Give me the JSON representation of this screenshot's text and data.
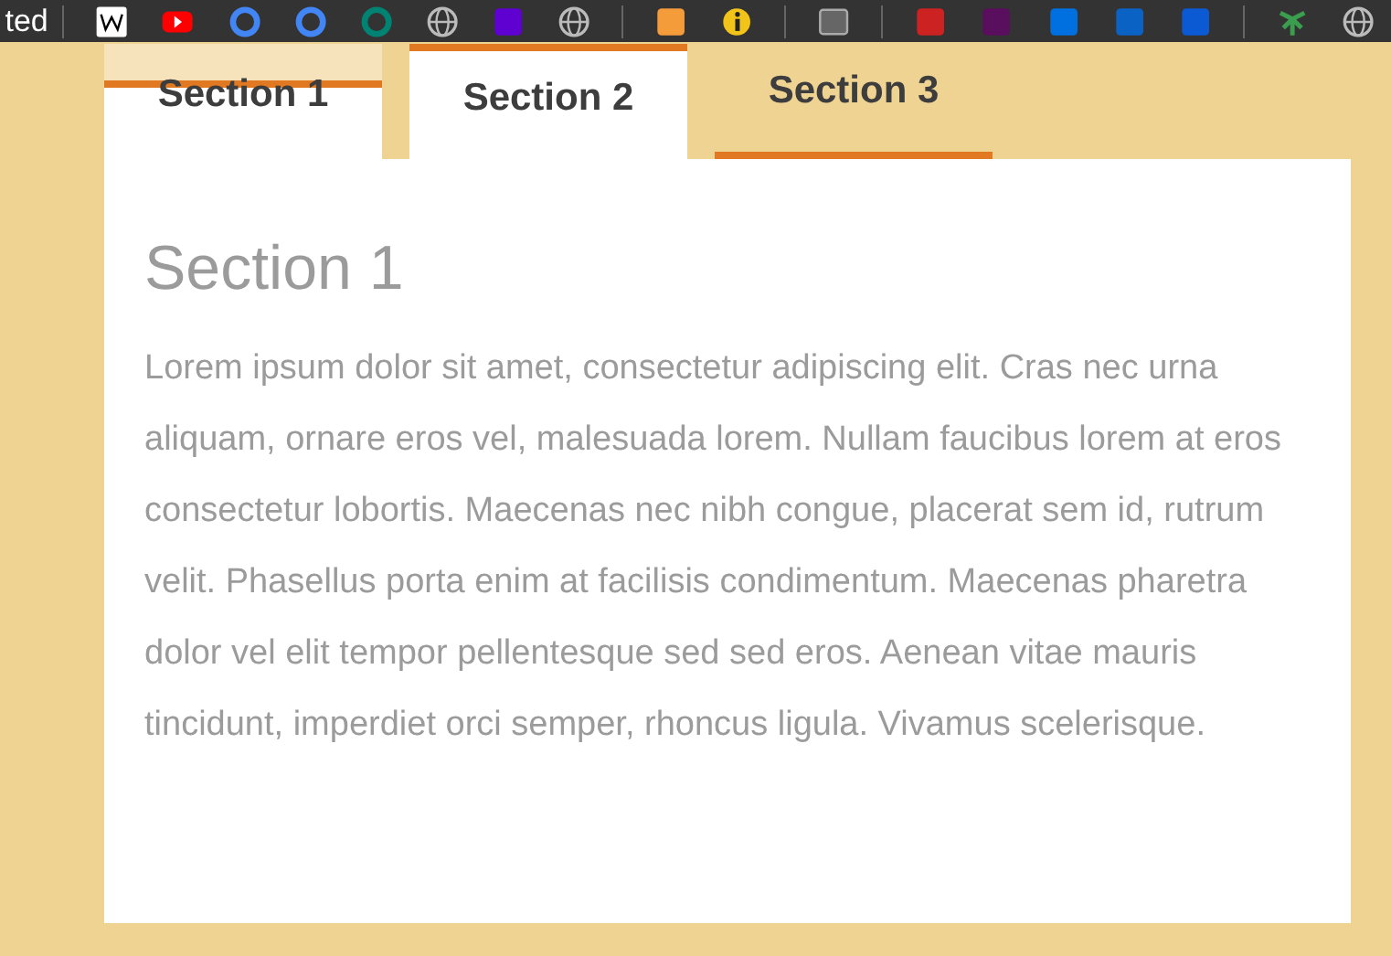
{
  "bookmarks_bar": {
    "label": "ted"
  },
  "tabs": [
    {
      "label": "Section 1",
      "kind": "raised"
    },
    {
      "label": "Section 2",
      "kind": "topbar"
    },
    {
      "label": "Section 3",
      "kind": "underlined"
    }
  ],
  "panel": {
    "heading": "Section 1",
    "text": "Lorem ipsum dolor sit amet, consectetur adipiscing elit. Cras nec urna aliquam, ornare eros vel, malesuada lorem. Nullam faucibus lorem at eros consectetur lobortis. Maecenas nec nibh congue, placerat sem id, rutrum velit. Phasellus porta enim at facilisis condimentum. Maecenas pharetra dolor vel elit tempor pellentesque sed sed eros. Aenean vitae mauris tincidunt, imperdiet orci semper, rhoncus ligula. Vivamus scelerisque."
  }
}
